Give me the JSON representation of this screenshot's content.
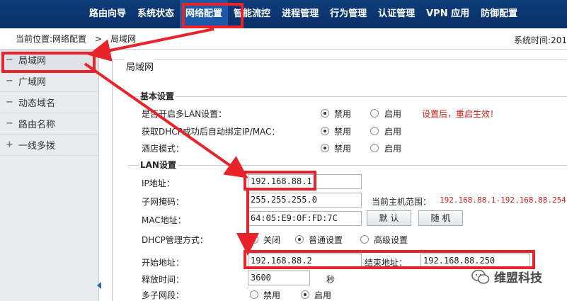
{
  "nav": {
    "items": [
      "路由向导",
      "系统状态",
      "网络配置",
      "智能流控",
      "进程管理",
      "行为管理",
      "认证管理",
      "VPN 应用",
      "防御配置"
    ]
  },
  "breadcrumb": {
    "prefix": "当前位置:网络配置",
    "sep": ">",
    "current": "局域网",
    "systime": "系统时间:201"
  },
  "sidebar": {
    "items": [
      {
        "mark": "−",
        "label": "局域网"
      },
      {
        "mark": "−",
        "label": "广域网"
      },
      {
        "mark": "−",
        "label": "动态域名"
      },
      {
        "mark": "−",
        "label": "路由名称"
      },
      {
        "mark": "+",
        "label": "一线多拨"
      }
    ]
  },
  "main": {
    "title": "局域网",
    "basic": {
      "legend": "基本设置",
      "multi_lan_label": "是否开启多LAN设置：",
      "dhcp_bind_label": "获取DHCP成功后自动绑定IP/MAC：",
      "hotel_label": "酒店模式：",
      "disable": "禁用",
      "enable": "启用",
      "restart_note": "设置后，重启生效！"
    },
    "lan": {
      "legend": "LAN设置",
      "ip_label": "IP地址：",
      "ip_value": "192.168.88.1",
      "mask_label": "子网掩码：",
      "mask_value": "255.255.255.0",
      "range_label": "当前主机范围：",
      "range_value": "192.168.88.1-192.168.88.254",
      "mac_label": "MAC地址：",
      "mac_value": "64:05:E9:0F:FD:7C",
      "default_button": "默 认",
      "random_button": "随 机",
      "dhcp_mode_label": "DHCP管理方式：",
      "dhcp_off": "关闭",
      "dhcp_normal": "普通设置",
      "dhcp_advanced": "高级设置",
      "start_label": "开始地址：",
      "start_value": "192.168.88.2",
      "end_label": "结束地址：",
      "end_value": "192.168.88.250",
      "lease_label": "释放时间：",
      "lease_value": "3600",
      "lease_unit": "秒",
      "multi_subnet_label": "多子网段：",
      "disable": "禁用",
      "enable": "启用"
    }
  },
  "watermark": {
    "text": "维盟科技"
  },
  "colors": {
    "nav_bg": "#0d3d7a",
    "highlight_red": "#e8242a",
    "note_red": "#d41d1d"
  }
}
